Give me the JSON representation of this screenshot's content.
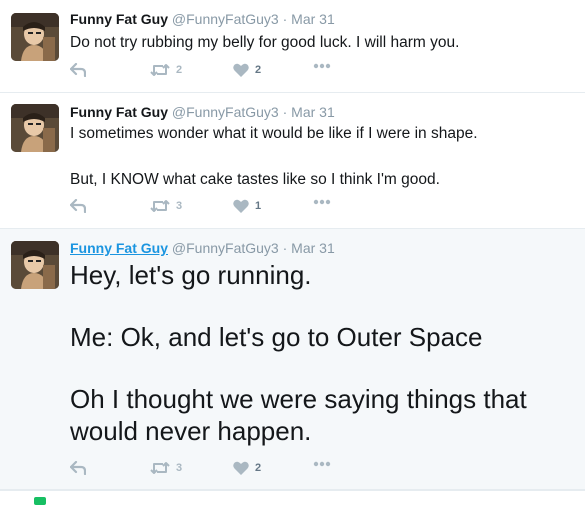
{
  "tweets": [
    {
      "name": "Funny Fat Guy",
      "handle": "@FunnyFatGuy3",
      "separator": "·",
      "time": "Mar 31",
      "paragraphs": [
        "Do not try rubbing my belly for good luck. I will harm you."
      ],
      "retweets": "2",
      "likes": "2"
    },
    {
      "name": "Funny Fat Guy",
      "handle": "@FunnyFatGuy3",
      "separator": "·",
      "time": "Mar 31",
      "paragraphs": [
        "I sometimes wonder what it would be like if I were in shape.",
        "But, I KNOW what cake tastes like so I think I'm good."
      ],
      "retweets": "3",
      "likes": "1"
    },
    {
      "name": "Funny Fat Guy",
      "handle": "@FunnyFatGuy3",
      "separator": "·",
      "time": "Mar 31",
      "paragraphs": [
        "Hey, let's go running.",
        "Me: Ok, and let's go to Outer Space",
        "Oh I thought we were saying things that would never happen."
      ],
      "retweets": "3",
      "likes": "2"
    }
  ],
  "next_row": {
    "text": ""
  },
  "colors": {
    "action_gray": "#aab8c2",
    "link_blue": "#1b95e0",
    "focus_bg": "#f5f8fa",
    "retweet_green": "#17bf63"
  },
  "icons": [
    "reply-icon",
    "retweet-icon",
    "heart-icon",
    "more-icon",
    "avatar"
  ]
}
